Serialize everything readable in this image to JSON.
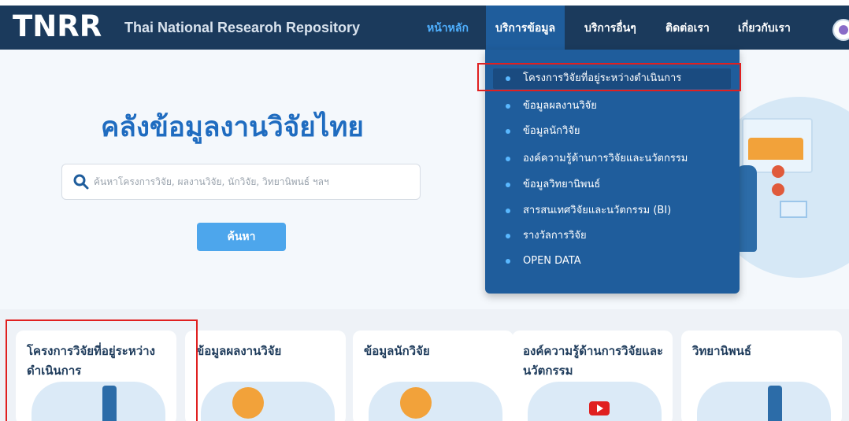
{
  "nav": {
    "logo": "TNRR",
    "subtitle": "Thai National Researoh Repository",
    "items": [
      {
        "label": "หน้าหลัก"
      },
      {
        "label": "บริการข้อมูล"
      },
      {
        "label": "บริการอื่นๆ"
      },
      {
        "label": "ติดต่อเรา"
      },
      {
        "label": "เกี่ยวกับเรา"
      }
    ]
  },
  "hero": {
    "title": "คลังข้อมูลงานวิจัยไทย",
    "search_placeholder": "ค้นหาโครงการวิจัย, ผลงานวิจัย, นักวิจัย, วิทยานิพนธ์ ฯลฯ",
    "search_button": "ค้นหา"
  },
  "dropdown": {
    "items": [
      {
        "label": "โครงการวิจัยที่อยู่ระหว่างดำเนินการ"
      },
      {
        "label": "ข้อมูลผลงานวิจัย"
      },
      {
        "label": "ข้อมูลนักวิจัย"
      },
      {
        "label": "องค์ความรู้ด้านการวิจัยและนวัตกรรม"
      },
      {
        "label": "ข้อมูลวิทยานิพนธ์"
      },
      {
        "label": "สารสนเทศวิจัยและนวัตกรรม (BI)"
      },
      {
        "label": "รางวัลการวิจัย"
      },
      {
        "label": "OPEN DATA"
      }
    ]
  },
  "cards": [
    {
      "title": "โครงการวิจัยที่อยู่ระหว่างดำเนินการ"
    },
    {
      "title": "ข้อมูลผลงานวิจัย"
    },
    {
      "title": "ข้อมูลนักวิจัย"
    },
    {
      "title": "องค์ความรู้ด้านการวิจัยและนวัตกรรม"
    },
    {
      "title": "วิทยานิพนธ์"
    }
  ],
  "colors": {
    "navbar": "#1b3a5c",
    "dropdown": "#1f5d9c",
    "accent": "#4da6ec",
    "title": "#1f6cc0",
    "highlight": "#e02020"
  }
}
